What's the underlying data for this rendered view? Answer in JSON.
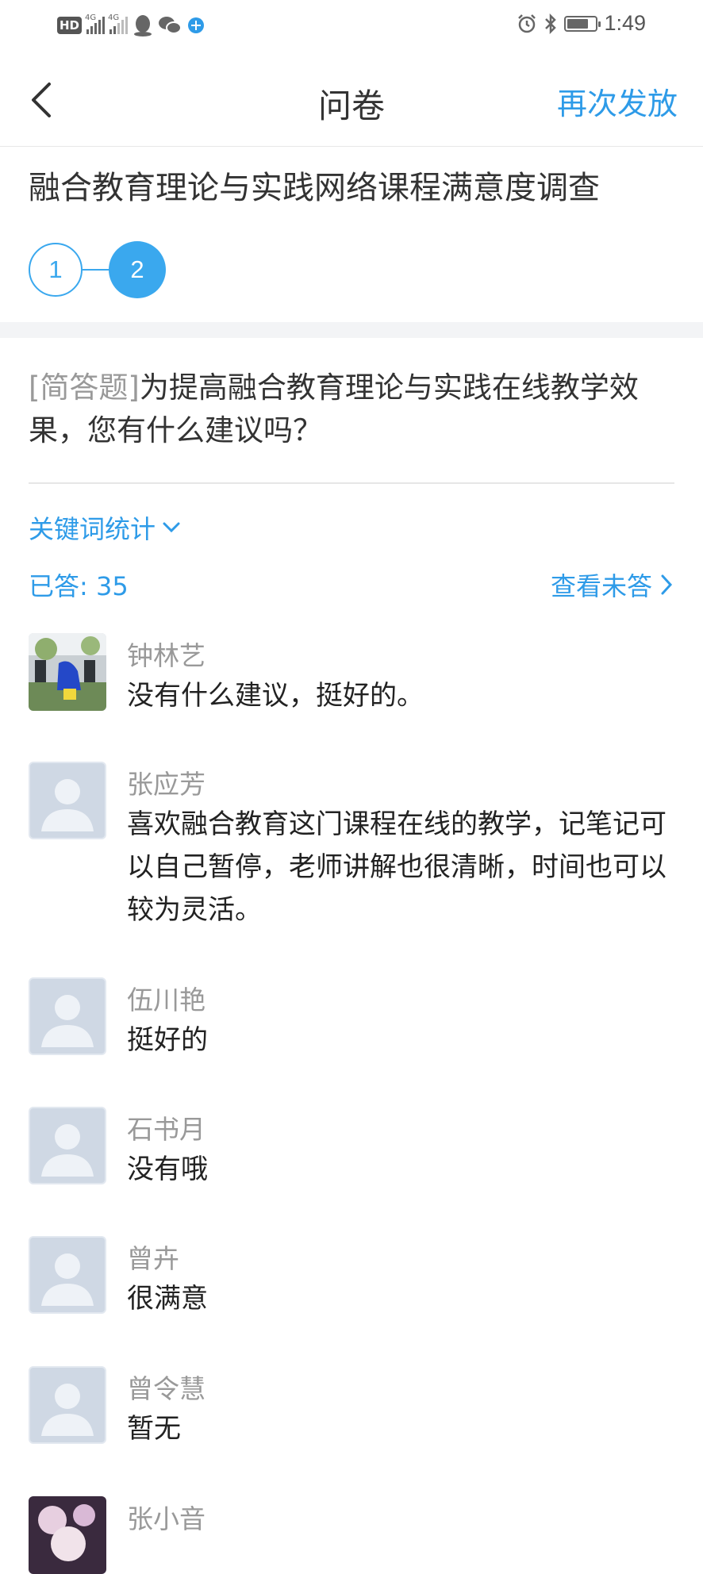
{
  "status_bar": {
    "badge": "HD",
    "network_1": "4G",
    "network_2": "4G",
    "time": "1:49",
    "battery_level": 0.75
  },
  "nav": {
    "title": "问卷",
    "action": "再次发放"
  },
  "survey": {
    "title": "融合教育理论与实践网络课程满意度调查",
    "steps": [
      "1",
      "2"
    ],
    "current_step": 2
  },
  "question": {
    "type": "[简答题]",
    "text": "为提高融合教育理论与实践在线教学效果，您有什么建议吗？"
  },
  "stats": {
    "keyword_label": "关键词统计",
    "answered_label": "已答: 35",
    "view_unanswered": "查看未答"
  },
  "answers": [
    {
      "name": "钟林艺",
      "text": "没有什么建议，挺好的。",
      "avatar": "photo"
    },
    {
      "name": "张应芳",
      "text": "喜欢融合教育这门课程在线的教学，记笔记可以自己暂停，老师讲解也很清晰，时间也可以较为灵活。",
      "avatar": "default"
    },
    {
      "name": "伍川艳",
      "text": "挺好的",
      "avatar": "default"
    },
    {
      "name": "石书月",
      "text": "没有哦",
      "avatar": "default"
    },
    {
      "name": "曾卉",
      "text": "很满意",
      "avatar": "default"
    },
    {
      "name": "曾令慧",
      "text": "暂无",
      "avatar": "default"
    },
    {
      "name": "张小音",
      "text": "",
      "avatar": "photo"
    }
  ]
}
